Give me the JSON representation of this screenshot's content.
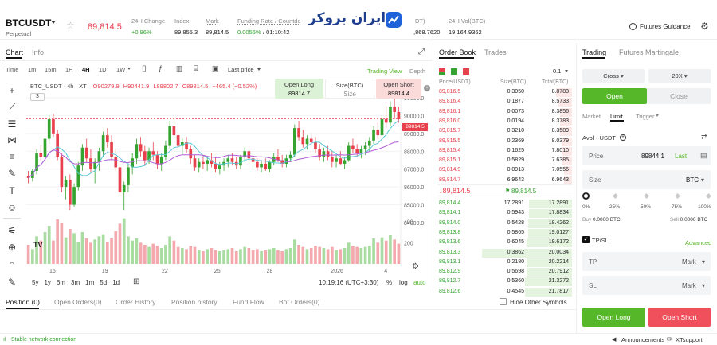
{
  "header": {
    "symbol": "BTCUSDT",
    "symbol_type": "Perpetual",
    "last_price": "89,814.5",
    "change_label": "24H Change",
    "change_value": "+0.96%",
    "index_label": "Index",
    "index_value": "89,855.3",
    "mark_label": "Mark",
    "mark_value": "89,814.5",
    "funding_label": "Funding Rate / Countdc",
    "funding_value": "0.0056%",
    "funding_countdown": "/ 01:10:42",
    "banner_text": "ایران بروکر",
    "hidden_label": "DT)",
    "hidden_value": ",868.7620",
    "vol_label": "24H Vol(BTC)",
    "vol_value": "19,164.9362",
    "guidance": "Futures Guidance"
  },
  "chart_tabs": {
    "chart": "Chart",
    "info": "Info"
  },
  "timeframes": [
    "Time",
    "1m",
    "15m",
    "1H",
    "4H",
    "1D",
    "1W"
  ],
  "chart_toolbar": {
    "last_price": "Last price",
    "trading_view": "Trading View",
    "depth": "Depth"
  },
  "chart_legend": {
    "title": "BTC_USDT · 4h · XT",
    "o": "O90279.9",
    "h": "H90441.9",
    "l": "L89802.7",
    "c": "C89814.5",
    "chg": "−465.4 (−0.52%)",
    "indicator_count": "3"
  },
  "chart_quick": {
    "open_long": "Open Long",
    "open_long_price": "89814.7",
    "size_label": "Size(BTC)",
    "size_value": "Size",
    "open_short": "Open Short",
    "open_short_price": "89814.4"
  },
  "chart_data": {
    "type": "candlestick",
    "y_ticks": [
      "91000.0",
      "90000.0",
      "89000.0",
      "88000.0",
      "87000.0",
      "86000.0",
      "85000.0",
      "84000.0",
      "400",
      "200"
    ],
    "x_ticks": [
      "16",
      "19",
      "22",
      "25",
      "28",
      "2026",
      "4"
    ],
    "last_label": "89814.5",
    "ylim": [
      84000,
      91800
    ],
    "candles": [
      [
        86600,
        86900,
        86200,
        86500
      ],
      [
        86500,
        87000,
        86300,
        86900
      ],
      [
        86900,
        88100,
        86700,
        87900
      ],
      [
        87900,
        88300,
        87500,
        87700
      ],
      [
        87700,
        88900,
        87200,
        88700
      ],
      [
        88700,
        90000,
        88400,
        89800
      ],
      [
        89800,
        90100,
        88800,
        89000
      ],
      [
        89000,
        89200,
        87500,
        87700
      ],
      [
        87700,
        87900,
        85700,
        86000
      ],
      [
        86000,
        86600,
        85300,
        86400
      ],
      [
        86400,
        86700,
        84700,
        85000
      ],
      [
        85000,
        86200,
        84900,
        86000
      ],
      [
        86000,
        87400,
        85800,
        87200
      ],
      [
        87200,
        88400,
        86900,
        88200
      ],
      [
        88200,
        88700,
        87400,
        87600
      ],
      [
        87600,
        88100,
        86800,
        87000
      ],
      [
        87000,
        87600,
        86200,
        87400
      ],
      [
        87400,
        88200,
        86900,
        88000
      ],
      [
        88000,
        89100,
        87700,
        88900
      ],
      [
        88900,
        89300,
        88200,
        88500
      ],
      [
        88500,
        88900,
        87500,
        87700
      ],
      [
        87700,
        88100,
        86900,
        87100
      ],
      [
        87100,
        87400,
        85500,
        85700
      ],
      [
        85700,
        86300,
        84700,
        86100
      ],
      [
        86100,
        87300,
        85700,
        87100
      ],
      [
        87100,
        87900,
        86700,
        87600
      ],
      [
        87600,
        88700,
        87300,
        88400
      ],
      [
        88400,
        88800,
        87700,
        88000
      ],
      [
        88000,
        88300,
        87200,
        87500
      ],
      [
        87500,
        88200,
        87300,
        88000
      ],
      [
        88000,
        88500,
        87500,
        87800
      ],
      [
        87800,
        88000,
        87000,
        87300
      ],
      [
        87300,
        87900,
        86900,
        87700
      ],
      [
        87700,
        88600,
        87500,
        88300
      ],
      [
        88300,
        89700,
        88100,
        89400
      ],
      [
        89400,
        89900,
        88700,
        88900
      ],
      [
        88900,
        89100,
        88000,
        88300
      ],
      [
        88300,
        88700,
        87800,
        88500
      ],
      [
        88500,
        88800,
        87900,
        88100
      ],
      [
        88100,
        88300,
        87300,
        87600
      ],
      [
        87600,
        87800,
        86900,
        87100
      ],
      [
        87100,
        87600,
        86800,
        87400
      ],
      [
        87400,
        87800,
        87000,
        87300
      ],
      [
        87300,
        87700,
        86900,
        87500
      ],
      [
        87500,
        87900,
        87100,
        87300
      ],
      [
        87300,
        87700,
        86800,
        87000
      ],
      [
        87000,
        87400,
        86700,
        87200
      ],
      [
        87200,
        87600,
        86900,
        87400
      ],
      [
        87400,
        87800,
        87100,
        87600
      ],
      [
        87600,
        87900,
        87200,
        87400
      ],
      [
        87400,
        87700,
        87000,
        87200
      ],
      [
        87200,
        87800,
        87000,
        87700
      ],
      [
        87700,
        88200,
        87400,
        88000
      ],
      [
        88000,
        88200,
        87300,
        87600
      ],
      [
        87600,
        87900,
        87100,
        87400
      ],
      [
        87400,
        87600,
        86900,
        87100
      ],
      [
        87100,
        87500,
        86800,
        87300
      ],
      [
        87300,
        87600,
        86900,
        87000
      ],
      [
        87000,
        87500,
        86800,
        87400
      ],
      [
        87400,
        87900,
        87200,
        87700
      ],
      [
        87700,
        88100,
        87400,
        87500
      ],
      [
        87500,
        87800,
        87100,
        87300
      ],
      [
        87300,
        87800,
        87100,
        87600
      ],
      [
        87600,
        88000,
        87400,
        87800
      ],
      [
        87800,
        89500,
        87700,
        89300
      ],
      [
        89300,
        89700,
        88600,
        88800
      ],
      [
        88800,
        89200,
        88200,
        88400
      ],
      [
        88400,
        88900,
        88100,
        88700
      ],
      [
        88700,
        89000,
        88300,
        88500
      ],
      [
        88500,
        88800,
        87900,
        88100
      ],
      [
        88100,
        88400,
        87500,
        87700
      ],
      [
        87700,
        88200,
        87400,
        88000
      ],
      [
        88000,
        88300,
        87500,
        87700
      ],
      [
        87700,
        88000,
        87100,
        87400
      ],
      [
        87400,
        87800,
        87100,
        87600
      ],
      [
        87600,
        88000,
        87200,
        87300
      ],
      [
        87300,
        87700,
        87000,
        87500
      ],
      [
        87500,
        88500,
        87400,
        88300
      ],
      [
        88300,
        88700,
        87900,
        88100
      ],
      [
        88100,
        88400,
        87700,
        87900
      ],
      [
        87900,
        88300,
        87600,
        88100
      ],
      [
        88100,
        88500,
        87800,
        88300
      ],
      [
        88300,
        88800,
        88000,
        88600
      ],
      [
        88600,
        89400,
        88400,
        89200
      ],
      [
        89200,
        89600,
        88700,
        88900
      ],
      [
        88900,
        90000,
        88800,
        89800
      ],
      [
        89800,
        90500,
        89300,
        89600
      ],
      [
        89600,
        90800,
        89400,
        90500
      ],
      [
        90500,
        91100,
        89800,
        90200
      ],
      [
        90200,
        90500,
        89600,
        89815
      ]
    ],
    "volume": [
      180,
      140,
      260,
      220,
      300,
      360,
      220,
      420,
      390,
      250,
      330,
      290,
      210,
      300,
      240,
      200,
      230,
      260,
      280,
      210,
      240,
      310,
      380,
      430,
      260,
      220,
      240,
      200,
      180,
      160,
      190,
      170,
      150,
      180,
      260,
      220,
      160,
      150,
      140,
      170,
      160,
      130,
      120,
      140,
      150,
      130,
      120,
      130,
      140,
      150,
      120,
      140,
      160,
      150,
      130,
      140,
      120,
      130,
      140,
      150,
      130,
      120,
      140,
      150,
      230,
      180,
      160,
      140,
      150,
      170,
      160,
      150,
      140,
      160,
      130,
      140,
      150,
      200,
      170,
      160,
      150,
      160,
      170,
      240,
      200,
      250,
      220,
      270,
      230,
      190
    ]
  },
  "chart_bottom": {
    "ranges": [
      "5y",
      "1y",
      "6m",
      "3m",
      "1m",
      "5d",
      "1d"
    ],
    "clock": "10:19:16 (UTC+3:30)",
    "pct": "%",
    "log": "log",
    "auto": "auto"
  },
  "orderbook": {
    "tab_book": "Order Book",
    "tab_trades": "Trades",
    "step": "0.1",
    "col_price": "Price(USDT)",
    "col_size": "Size(BTC)",
    "col_total": "Total(BTC)",
    "asks": [
      [
        "89,816.5",
        "0.3050",
        "8.8783"
      ],
      [
        "89,816.4",
        "0.1877",
        "8.5733"
      ],
      [
        "89,816.1",
        "0.0073",
        "8.3856"
      ],
      [
        "89,816.0",
        "0.0194",
        "8.3783"
      ],
      [
        "89,815.7",
        "0.3210",
        "8.3589"
      ],
      [
        "89,815.5",
        "0.2369",
        "8.0379"
      ],
      [
        "89,815.4",
        "0.1625",
        "7.8010"
      ],
      [
        "89,815.1",
        "0.5829",
        "7.6385"
      ],
      [
        "89,814.9",
        "0.0913",
        "7.0556"
      ],
      [
        "89,814.7",
        "6.9643",
        "6.9643"
      ]
    ],
    "ask_depth": [
      0.12,
      0.1,
      0.09,
      0.09,
      0.09,
      0.08,
      0.08,
      0.07,
      0.06,
      0.06
    ],
    "mid_price": "↓89,814.5",
    "mark_price": "89,814.5",
    "bids": [
      [
        "89,814.4",
        "17.2891",
        "17.2891"
      ],
      [
        "89,814.1",
        "0.5943",
        "17.8834"
      ],
      [
        "89,814.0",
        "0.5428",
        "18.4262"
      ],
      [
        "89,813.8",
        "0.5865",
        "19.0127"
      ],
      [
        "89,813.6",
        "0.6045",
        "19.6172"
      ],
      [
        "89,813.3",
        "0.3862",
        "20.0034"
      ],
      [
        "89,813.1",
        "0.2180",
        "20.2214"
      ],
      [
        "89,812.9",
        "0.5698",
        "20.7912"
      ],
      [
        "89,812.7",
        "0.5360",
        "21.3272"
      ],
      [
        "89,812.6",
        "0.4545",
        "21.7817"
      ]
    ],
    "bid_depth": [
      0.32,
      0.32,
      0.33,
      0.33,
      0.34,
      0.67,
      0.34,
      0.34,
      0.35,
      0.35
    ]
  },
  "trading": {
    "tab_trading": "Trading",
    "tab_martingale": "Futures Martingale",
    "margin_mode": "Cross",
    "leverage": "20X",
    "open": "Open",
    "close": "Close",
    "order_types": [
      "Market",
      "Limit",
      "Trigger"
    ],
    "avbl": "Avbl --USDT",
    "price_label": "Price",
    "price_value": "89844.1",
    "price_last": "Last",
    "size_label": "Size",
    "size_unit": "BTC",
    "slider_marks": [
      "0%",
      "25%",
      "50%",
      "75%",
      "100%"
    ],
    "buy_label": "Buy",
    "buy_value": "0.0000 BTC",
    "sell_label": "Sell",
    "sell_value": "0.0000 BTC",
    "tpsl": "TP/SL",
    "advanced": "Advanced",
    "tp": "TP",
    "sl": "SL",
    "mark": "Mark",
    "open_long": "Open Long",
    "open_short": "Open Short"
  },
  "bottom_tabs": [
    "Position (0)",
    "Open Orders(0)",
    "Order History",
    "Position history",
    "Fund Flow",
    "Bot Orders(0)"
  ],
  "hide_other": "Hide Other Symbols",
  "status": {
    "network": "Stable network connection",
    "announcements": "Announcements",
    "support": "XTsupport"
  },
  "colors": {
    "up": "#35a32f",
    "down": "#e8404c",
    "accent": "#56b829"
  }
}
